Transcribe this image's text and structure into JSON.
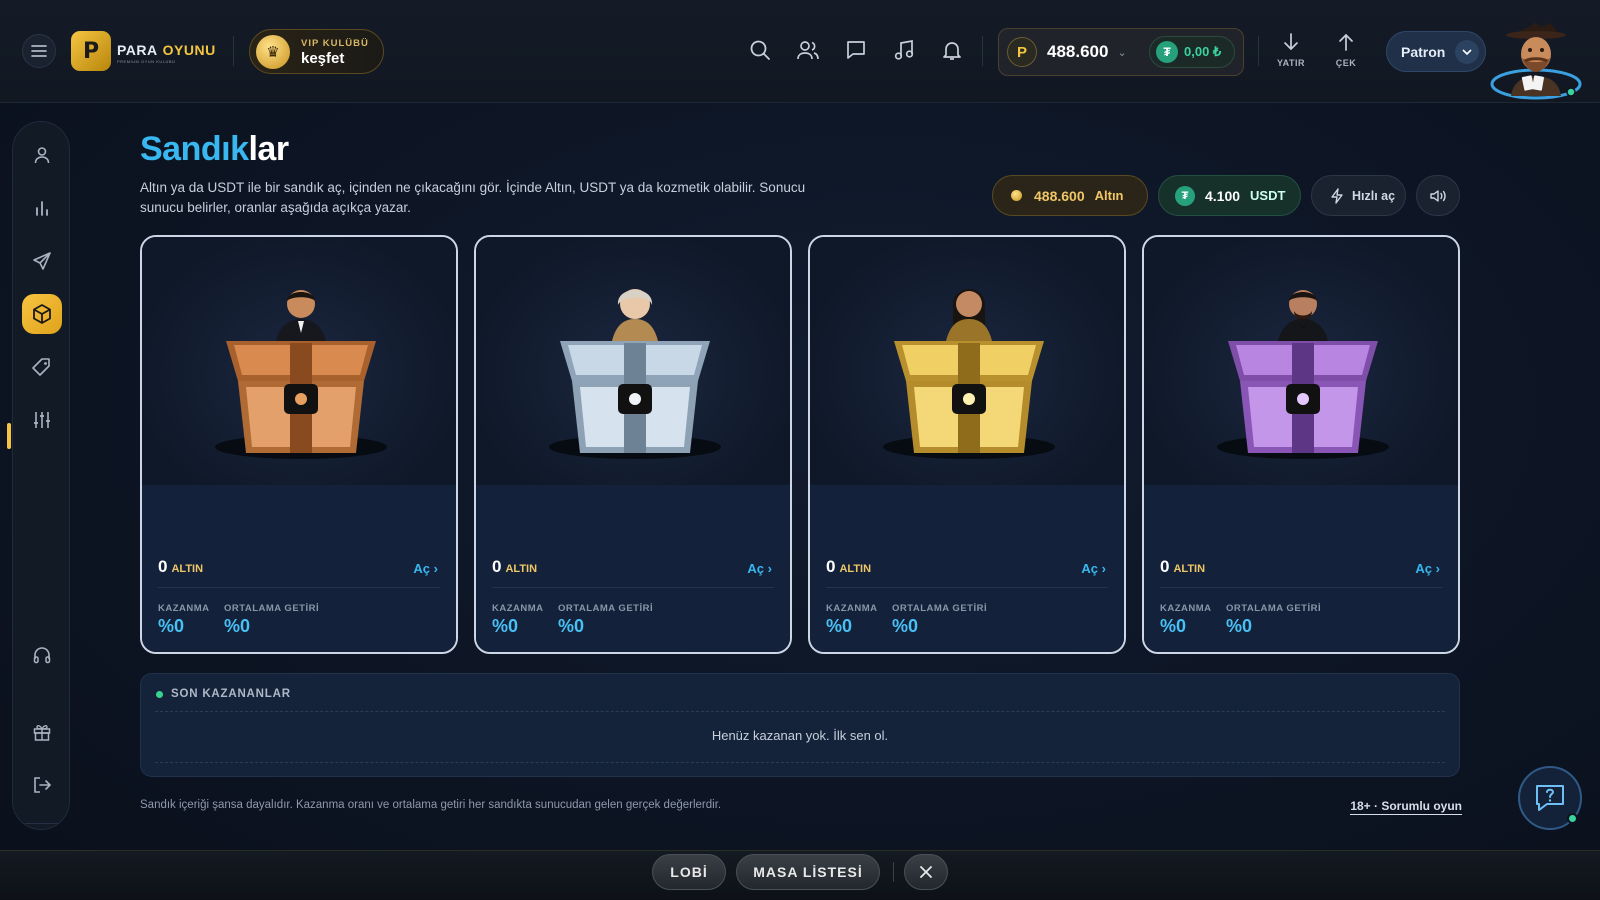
{
  "header": {
    "brand_word1": "PARA",
    "brand_word2": "OYUNU",
    "brand_sub": "PREMIUM OYUN KULÜBÜ",
    "vip_small": "VIP KULÜBÜ",
    "vip_big": "keşfet",
    "balance": "488.600",
    "usdt_balance": "0,00 ₺",
    "deposit": "YATIR",
    "withdraw": "ÇEK",
    "user": "Patron"
  },
  "page": {
    "title_part1": "Sandık",
    "title_part2": "lar",
    "description": "Altın ya da USDT ile bir sandık aç, içinden ne çıkacağını gör. İçinde Altın, USDT ya da kozmetik olabilir. Sonucu sunucu belirler, oranlar aşağıda açıkça yazar.",
    "gold_pill_value": "488.600",
    "gold_pill_unit": "Altın",
    "usdt_pill_value": "4.100",
    "usdt_pill_unit": "USDT",
    "fast_open": "Hızlı aç"
  },
  "chests": [
    {
      "tier": "bronze",
      "amount": "0",
      "unit": "ALTIN",
      "open": "Aç",
      "win_label": "KAZANMA",
      "win_value": "%0",
      "avg_label": "ORTALAMA GETİRİ",
      "avg_value": "%0"
    },
    {
      "tier": "silver",
      "amount": "0",
      "unit": "ALTIN",
      "open": "Aç",
      "win_label": "KAZANMA",
      "win_value": "%0",
      "avg_label": "ORTALAMA GETİRİ",
      "avg_value": "%0"
    },
    {
      "tier": "gold",
      "amount": "0",
      "unit": "ALTIN",
      "open": "Aç",
      "win_label": "KAZANMA",
      "win_value": "%0",
      "avg_label": "ORTALAMA GETİRİ",
      "avg_value": "%0"
    },
    {
      "tier": "purple",
      "amount": "0",
      "unit": "ALTIN",
      "open": "Aç",
      "win_label": "KAZANMA",
      "win_value": "%0",
      "avg_label": "ORTALAMA GETİRİ",
      "avg_value": "%0"
    }
  ],
  "winners": {
    "heading": "SON KAZANANLAR",
    "empty": "Henüz kazanan yok. İlk sen ol."
  },
  "footer": {
    "note": "Sandık içeriği şansa dayalıdır. Kazanma oranı ve ortalama getiri her sandıkta sunucudan gelen gerçek değerlerdir.",
    "responsible": "18+ · Sorumlu oyun"
  },
  "dock": {
    "lobby": "LOBİ",
    "table_list": "MASA LİSTESİ"
  },
  "colors": {
    "accent_blue": "#38b7f0",
    "gold": "#f5c542",
    "usdt_green": "#26a17b"
  }
}
